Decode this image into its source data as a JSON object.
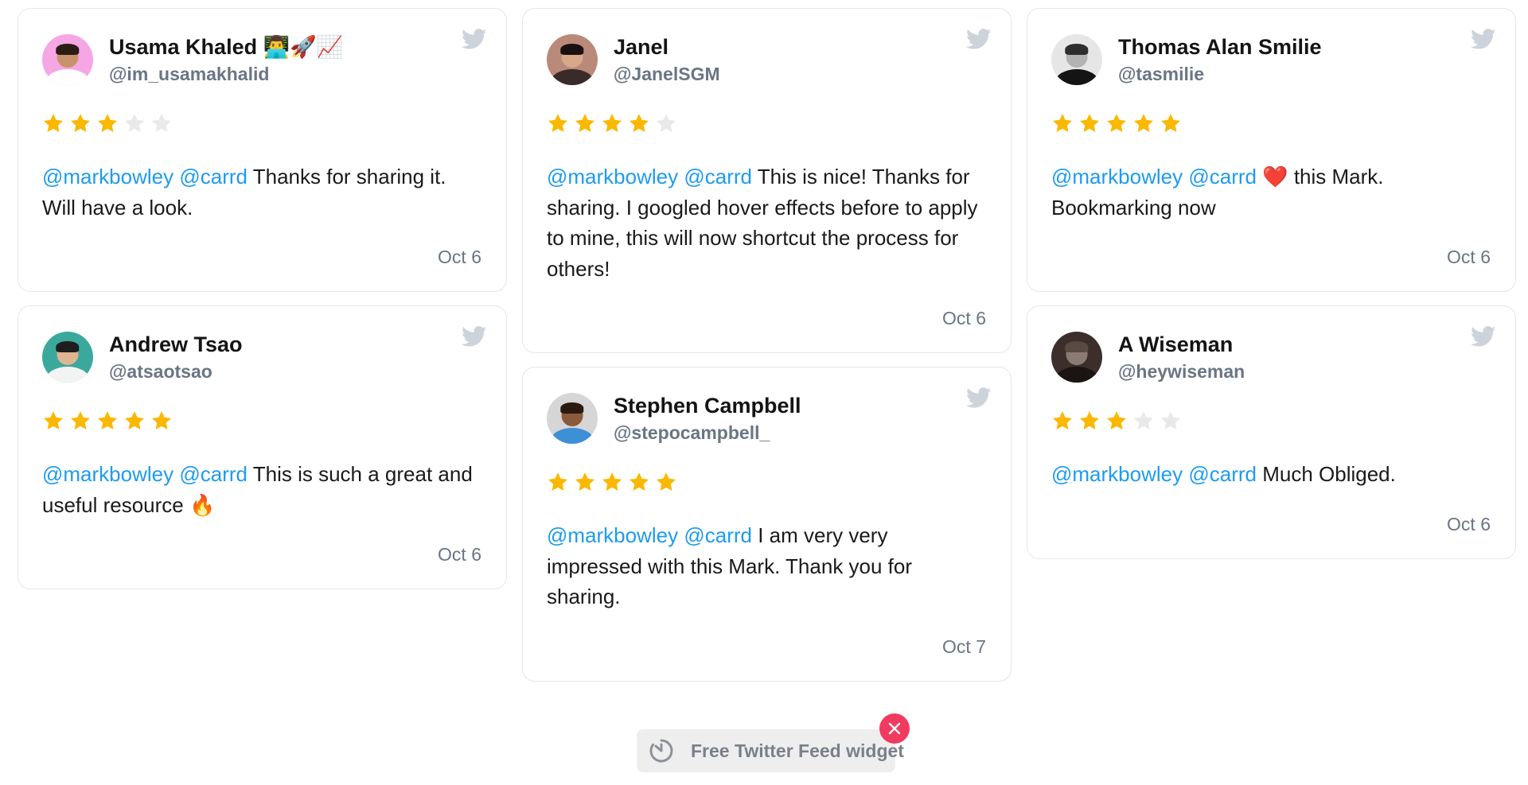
{
  "colors": {
    "mention": "#1d9bf0",
    "star_filled": "#fbb800",
    "star_empty": "#e9e9e9",
    "twitter_icon": "#cdd3da",
    "close_button": "#f03a5f"
  },
  "columns": [
    [
      {
        "name": "Usama Khaled 👨‍💻🚀📈",
        "handle": "@im_usamakhalid",
        "rating": 3,
        "mentions": [
          "@markbowley",
          "@carrd"
        ],
        "text": "Thanks for sharing it. Will have a look.",
        "date": "Oct 6",
        "avatar": {
          "bg": "#f6a6e4",
          "face": "#c9926a",
          "body": "#ffffff",
          "hair": "#2a1d14"
        }
      },
      {
        "name": "Andrew Tsao",
        "handle": "@atsaotsao",
        "rating": 5,
        "mentions": [
          "@markbowley",
          "@carrd"
        ],
        "text": "This is such a great and useful resource 🔥",
        "date": "Oct 6",
        "avatar": {
          "bg": "#3aa99c",
          "face": "#e0b592",
          "body": "#f3f3f3",
          "hair": "#1e1e1e"
        }
      }
    ],
    [
      {
        "name": "Janel",
        "handle": "@JanelSGM",
        "rating": 4,
        "mentions": [
          "@markbowley",
          "@carrd"
        ],
        "text": "This is nice! Thanks for sharing. I googled hover effects before to apply to mine, this will now shortcut the process for others!",
        "date": "Oct 6",
        "avatar": {
          "bg": "#b98a7a",
          "face": "#d9a88a",
          "body": "#3a2a2a",
          "hair": "#1a1010"
        }
      },
      {
        "name": "Stephen Campbell",
        "handle": "@stepocampbell_",
        "rating": 5,
        "mentions": [
          "@markbowley",
          "@carrd"
        ],
        "text": "I am very very impressed with this Mark. Thank you for sharing.",
        "date": "Oct 7",
        "avatar": {
          "bg": "#d6d6d6",
          "face": "#8a5a3a",
          "body": "#3d8fd6",
          "hair": "#2a1a10"
        }
      }
    ],
    [
      {
        "name": "Thomas Alan Smilie",
        "handle": "@tasmilie",
        "rating": 5,
        "mentions": [
          "@markbowley",
          "@carrd"
        ],
        "text": "❤️ this Mark. Bookmarking now",
        "date": "Oct 6",
        "avatar": {
          "bg": "#e6e6e6",
          "face": "#b3b3b3",
          "body": "#141414",
          "hair": "#2e2e2e"
        }
      },
      {
        "name": "A Wiseman",
        "handle": "@heywiseman",
        "rating": 3,
        "mentions": [
          "@markbowley",
          "@carrd"
        ],
        "text": "Much Obliged.",
        "date": "Oct 6",
        "avatar": {
          "bg": "#3b2e2b",
          "face": "#8a7b74",
          "body": "#1a1412",
          "hair": "#5a4a44"
        }
      }
    ]
  ],
  "footer": {
    "badge_label": "Free Twitter Feed widget",
    "close_icon": "close-icon",
    "logo_icon": "widget-logo-icon"
  }
}
